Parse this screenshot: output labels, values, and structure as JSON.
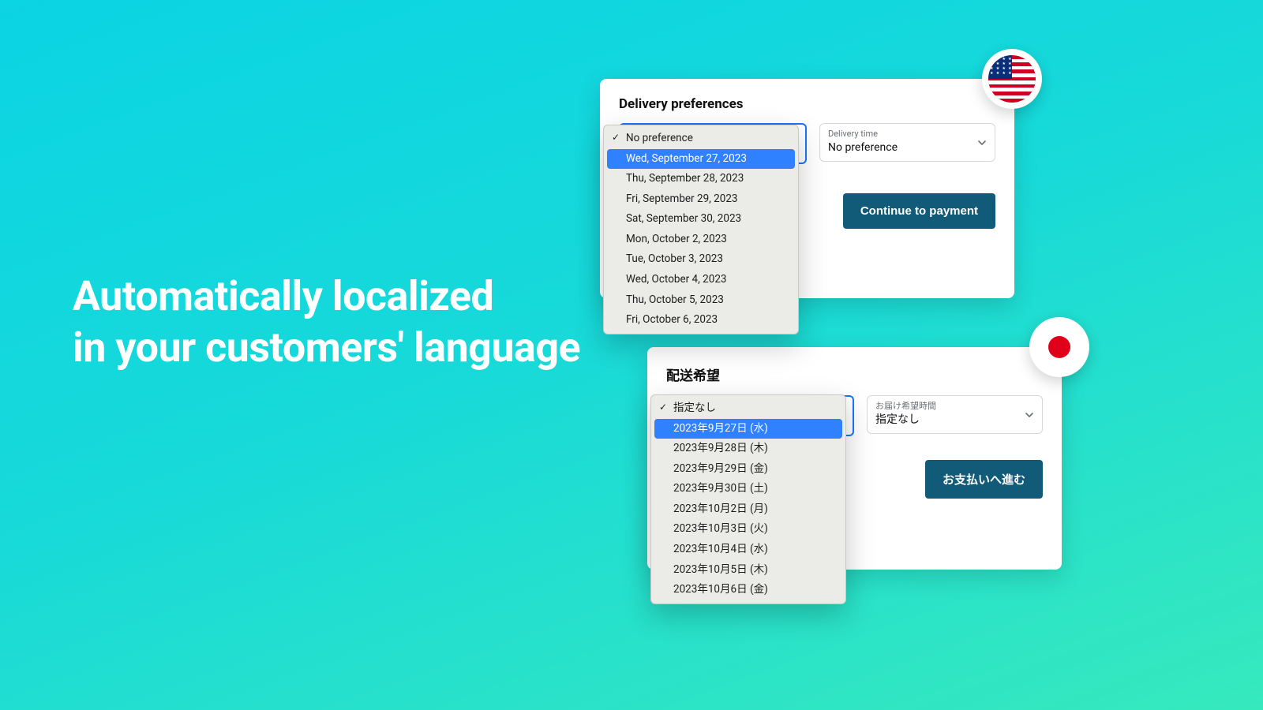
{
  "headline": {
    "line1": "Automatically localized",
    "line2": "in your customers' language"
  },
  "flags": {
    "us": "us-flag",
    "jp": "jp-flag"
  },
  "card_en": {
    "title": "Delivery preferences",
    "time_label": "Delivery time",
    "time_value": "No preference",
    "cta": "Continue to payment",
    "options": [
      {
        "label": "No preference",
        "checked": true,
        "selected": false
      },
      {
        "label": "Wed, September 27, 2023",
        "checked": false,
        "selected": true
      },
      {
        "label": "Thu, September 28, 2023",
        "checked": false,
        "selected": false
      },
      {
        "label": "Fri, September 29, 2023",
        "checked": false,
        "selected": false
      },
      {
        "label": "Sat, September 30, 2023",
        "checked": false,
        "selected": false
      },
      {
        "label": "Mon, October 2, 2023",
        "checked": false,
        "selected": false
      },
      {
        "label": "Tue, October 3, 2023",
        "checked": false,
        "selected": false
      },
      {
        "label": "Wed, October 4, 2023",
        "checked": false,
        "selected": false
      },
      {
        "label": "Thu, October 5, 2023",
        "checked": false,
        "selected": false
      },
      {
        "label": "Fri, October 6, 2023",
        "checked": false,
        "selected": false
      }
    ]
  },
  "card_jp": {
    "title": "配送希望",
    "time_label": "お届け希望時間",
    "time_value": "指定なし",
    "cta": "お支払いへ進む",
    "options": [
      {
        "label": "指定なし",
        "checked": true,
        "selected": false
      },
      {
        "label": "2023年9月27日 (水)",
        "checked": false,
        "selected": true
      },
      {
        "label": "2023年9月28日 (木)",
        "checked": false,
        "selected": false
      },
      {
        "label": "2023年9月29日 (金)",
        "checked": false,
        "selected": false
      },
      {
        "label": "2023年9月30日 (土)",
        "checked": false,
        "selected": false
      },
      {
        "label": "2023年10月2日 (月)",
        "checked": false,
        "selected": false
      },
      {
        "label": "2023年10月3日 (火)",
        "checked": false,
        "selected": false
      },
      {
        "label": "2023年10月4日 (水)",
        "checked": false,
        "selected": false
      },
      {
        "label": "2023年10月5日 (木)",
        "checked": false,
        "selected": false
      },
      {
        "label": "2023年10月6日 (金)",
        "checked": false,
        "selected": false
      }
    ]
  },
  "colors": {
    "accent": "#2f81ff",
    "cta": "#125b78"
  }
}
